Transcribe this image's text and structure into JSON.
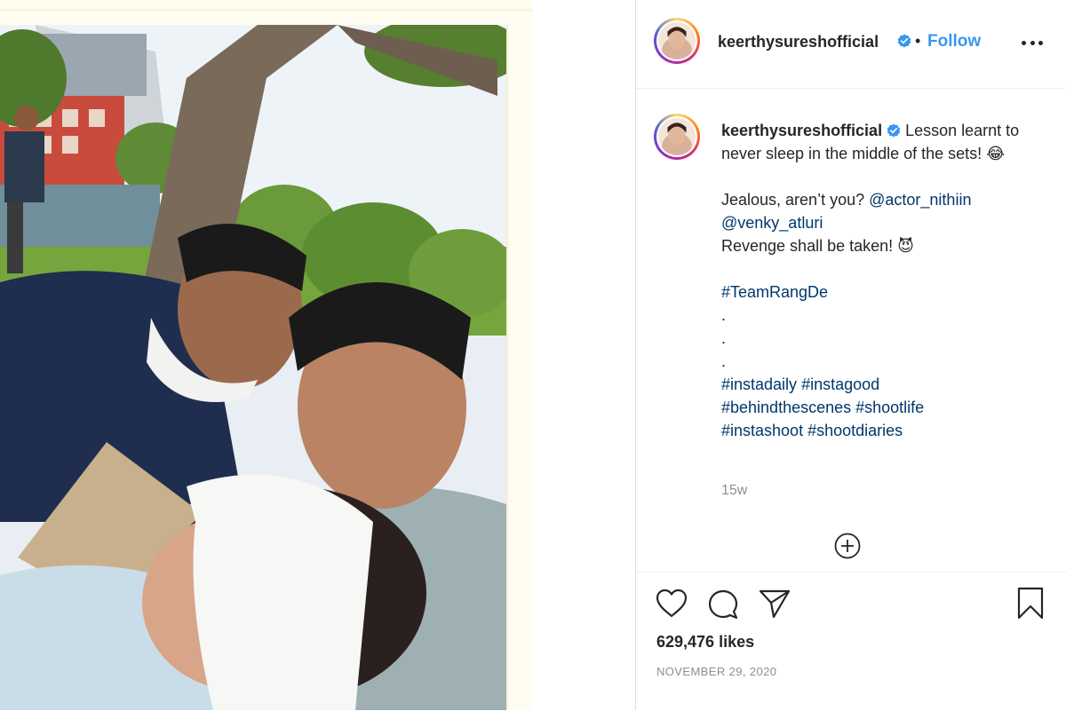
{
  "post": {
    "username": "keerthysureshofficial",
    "verified": true,
    "follow_label": "Follow",
    "separator": "•",
    "more_options_icon": "more-horizontal-icon"
  },
  "caption": {
    "username": "keerthysureshofficial",
    "line1": "Lesson learnt to never sleep in the middle of the sets! 😂",
    "jealous_text": "Jealous, aren’t you?",
    "mention1": "@actor_nithiin",
    "mention2": "@venky_atluri",
    "revenge_text": "Revenge shall be taken! 😈",
    "hashtag_team": "#TeamRangDe",
    "dot1": ".",
    "dot2": ".",
    "dot3": ".",
    "tags": [
      "#instadaily",
      "#instagood",
      "#behindthescenes",
      "#shootlife",
      "#instashoot",
      "#shootdiaries"
    ],
    "time_ago": "15w"
  },
  "actions": {
    "like_icon": "heart-icon",
    "comment_icon": "comment-icon",
    "share_icon": "paper-plane-icon",
    "save_icon": "bookmark-icon",
    "load_more_icon": "plus-circle-icon"
  },
  "likes": "629,476 likes",
  "date": "NOVEMBER 29, 2020",
  "colors": {
    "link_blue": "#3897f0",
    "hashtag_blue": "#00376b",
    "muted_gray": "#8e8e8e",
    "text_dark": "#262626"
  }
}
